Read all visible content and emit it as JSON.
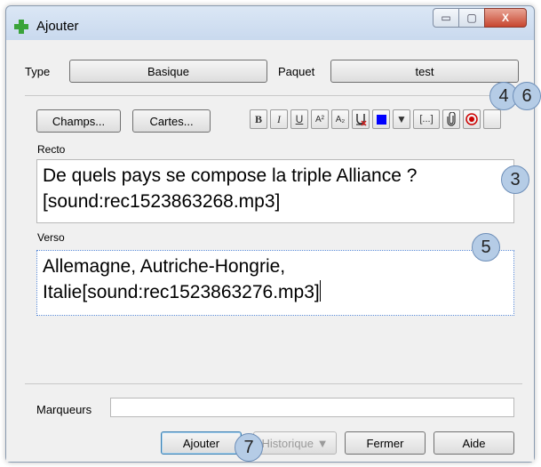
{
  "window": {
    "title": "Ajouter"
  },
  "window_controls": {
    "minimize": "▭",
    "maximize": "▢",
    "close": "X"
  },
  "note_type": {
    "label": "Type",
    "value": "Basique"
  },
  "deck": {
    "label": "Paquet",
    "value": "test"
  },
  "toolbar": {
    "fields_button": "Champs...",
    "cards_button": "Cartes...",
    "format": {
      "bold": "B",
      "italic": "I",
      "underline": "U",
      "superscript": "A²",
      "subscript": "A₂",
      "cloze": "[...]"
    }
  },
  "front": {
    "label": "Recto",
    "text": "De quels pays se compose la triple Alliance ? [sound:rec1523863268.mp3]"
  },
  "back": {
    "label": "Verso",
    "text": "Allemagne, Autriche-Hongrie, Italie[sound:rec1523863276.mp3]"
  },
  "tags": {
    "label": "Marqueurs",
    "value": ""
  },
  "actions": {
    "add": "Ajouter",
    "history": "Historique ▼",
    "close": "Fermer",
    "help": "Aide"
  },
  "badges": {
    "b3": "3",
    "b4": "4",
    "b5": "5",
    "b6": "6",
    "b7": "7"
  },
  "colors": {
    "text_color_swatch": "#0000ff",
    "record_icon": "#cc0000",
    "plus_icon": "#3aa33a",
    "badge_fill": "#b5cce6"
  }
}
